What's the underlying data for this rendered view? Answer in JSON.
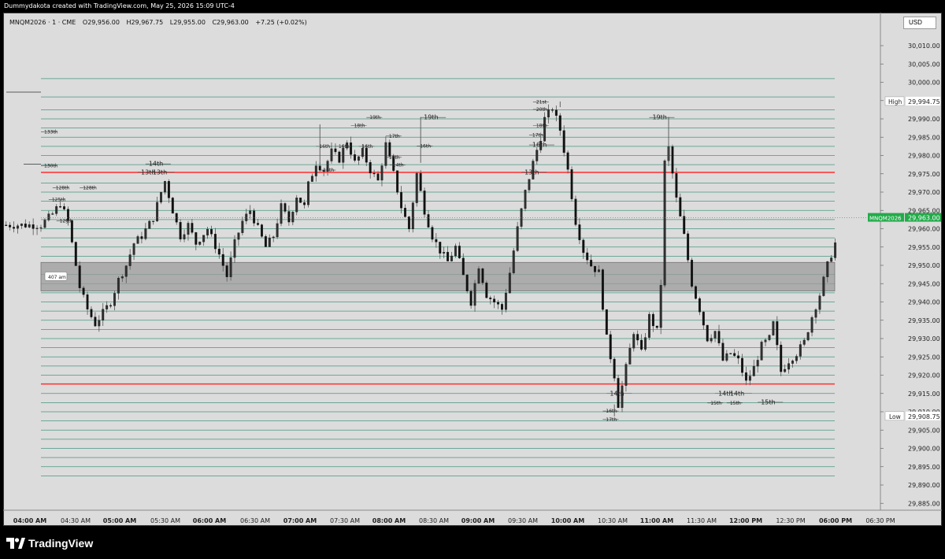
{
  "header": {
    "credit": "Dummydakota created with TradingView.com, May 25, 2026 15:09 UTC-4"
  },
  "legend": {
    "symbol": "MNQM2026 · 1 · CME",
    "open": "O29,956.00",
    "high": "H29,967.75",
    "low": "L29,955.00",
    "close": "C29,963.00",
    "change": "+7.25 (+0.02%)"
  },
  "currency": "USD",
  "brand": "TradingView",
  "colors": {
    "pane_bg": "#dcdcdc",
    "candle": "#111111",
    "candle_wick": "#555555",
    "level_line": "#2e8b72",
    "red_line": "#ff3b3b",
    "zone_fill": "#9c9c9c",
    "price_tag": "#22ab4a"
  },
  "chart_data": {
    "type": "candlestick",
    "symbol": "MNQM2026",
    "interval": "1",
    "y_range": [
      29882.5,
      30015
    ],
    "y_ticks": [
      "30,010.00",
      "30,005.00",
      "30,000.00",
      "29,995.00",
      "29,990.00",
      "29,985.00",
      "29,980.00",
      "29,975.00",
      "29,970.00",
      "29,965.00",
      "29,960.00",
      "29,955.00",
      "29,950.00",
      "29,945.00",
      "29,940.00",
      "29,935.00",
      "29,930.00",
      "29,925.00",
      "29,920.00",
      "29,915.00",
      "29,910.00",
      "29,905.00",
      "29,900.00",
      "29,895.00",
      "29,890.00",
      "29,885.00"
    ],
    "x_ticks": [
      "04:00 AM",
      "04:30 AM",
      "05:00 AM",
      "05:30 AM",
      "06:00 AM",
      "06:30 AM",
      "07:00 AM",
      "07:30 AM",
      "08:00 AM",
      "08:30 AM",
      "09:00 AM",
      "09:30 AM",
      "10:00 AM",
      "10:30 AM",
      "11:00 AM",
      "11:30 AM",
      "12:00 PM",
      "12:30 PM",
      "06:00 PM",
      "06:30 PM"
    ],
    "x_ticks_bold": [
      "04:00 AM",
      "05:00 AM",
      "06:00 AM",
      "07:00 AM",
      "08:00 AM",
      "09:00 AM",
      "10:00 AM",
      "11:00 AM",
      "12:00 PM",
      "06:00 PM"
    ],
    "high_label": {
      "text": "High",
      "value": "29,994.75",
      "price": 29994.75
    },
    "low_label": {
      "text": "Low",
      "value": "29,908.75",
      "price": 29908.75
    },
    "last_price": {
      "symbol": "MNQM2026",
      "value": "29,963.00",
      "price": 29963.0
    },
    "red_levels": [
      29975.4,
      29917.6
    ],
    "zone": {
      "from": 29943.0,
      "to": 29950.8,
      "label": "407 am"
    },
    "level_lines": [
      30001,
      29996,
      29992.5,
      29990,
      29987.5,
      29985,
      29982.5,
      29980,
      29977.5,
      29972.5,
      29970,
      29967.5,
      29965,
      29962.5,
      29960,
      29957.5,
      29955,
      29952.5,
      29947.5,
      29945,
      29942.5,
      29940,
      29937.5,
      29935,
      29932.5,
      29930,
      29927.5,
      29925,
      29922.5,
      29920,
      29915,
      29912.5,
      29910,
      29907.5,
      29905,
      29902.5,
      29900,
      29897.5,
      29895,
      29892.5
    ],
    "price_path": [
      [
        0,
        29961
      ],
      [
        3,
        29964
      ],
      [
        5,
        29967
      ],
      [
        7,
        29962
      ],
      [
        9,
        29950
      ],
      [
        10,
        29944
      ],
      [
        12,
        29938
      ],
      [
        14,
        29934
      ],
      [
        16,
        29937
      ],
      [
        18,
        29940
      ],
      [
        20,
        29946
      ],
      [
        22,
        29950
      ],
      [
        24,
        29956
      ],
      [
        26,
        29958
      ],
      [
        29,
        29963
      ],
      [
        31,
        29970
      ],
      [
        32,
        29973
      ],
      [
        34,
        29965
      ],
      [
        36,
        29958
      ],
      [
        38,
        29961
      ],
      [
        40,
        29956
      ],
      [
        43,
        29960
      ],
      [
        46,
        29953
      ],
      [
        48,
        29947
      ],
      [
        50,
        29956
      ],
      [
        52,
        29962
      ],
      [
        54,
        29965
      ],
      [
        56,
        29960
      ],
      [
        58,
        29955
      ],
      [
        60,
        29958
      ],
      [
        62,
        29966
      ],
      [
        64,
        29962
      ],
      [
        66,
        29969
      ],
      [
        68,
        29966
      ],
      [
        69,
        29972
      ],
      [
        71,
        29978
      ],
      [
        73,
        29976
      ],
      [
        75,
        29981
      ],
      [
        77,
        29979
      ],
      [
        79,
        29984
      ],
      [
        81,
        29978
      ],
      [
        83,
        29981
      ],
      [
        85,
        29976
      ],
      [
        87,
        29973
      ],
      [
        89,
        29983
      ],
      [
        91,
        29975
      ],
      [
        93,
        29966
      ],
      [
        95,
        29960
      ],
      [
        97,
        29975
      ],
      [
        99,
        29965
      ],
      [
        101,
        29958
      ],
      [
        103,
        29954
      ],
      [
        105,
        29951
      ],
      [
        107,
        29955
      ],
      [
        109,
        29947
      ],
      [
        111,
        29940
      ],
      [
        113,
        29950
      ],
      [
        115,
        29942
      ],
      [
        117,
        29940
      ],
      [
        119,
        29938
      ],
      [
        121,
        29948
      ],
      [
        123,
        29960
      ],
      [
        125,
        29970
      ],
      [
        127,
        29978
      ],
      [
        129,
        29985
      ],
      [
        130,
        29990
      ],
      [
        132,
        29993
      ],
      [
        134,
        29987
      ],
      [
        136,
        29976
      ],
      [
        138,
        29962
      ],
      [
        140,
        29954
      ],
      [
        142,
        29950
      ],
      [
        144,
        29948
      ],
      [
        146,
        29930
      ],
      [
        148,
        29920
      ],
      [
        149,
        29912
      ],
      [
        151,
        29922
      ],
      [
        153,
        29932
      ],
      [
        155,
        29926
      ],
      [
        157,
        29936
      ],
      [
        159,
        29932
      ],
      [
        160,
        29945
      ],
      [
        161,
        29978
      ],
      [
        162,
        29982
      ],
      [
        164,
        29968
      ],
      [
        166,
        29958
      ],
      [
        168,
        29945
      ],
      [
        170,
        29938
      ],
      [
        172,
        29930
      ],
      [
        174,
        29932
      ],
      [
        176,
        29924
      ],
      [
        178,
        29926
      ],
      [
        180,
        29924
      ],
      [
        182,
        29918
      ],
      [
        184,
        29922
      ],
      [
        186,
        29928
      ],
      [
        188,
        29930
      ],
      [
        189,
        29934
      ],
      [
        191,
        29921
      ],
      [
        193,
        29924
      ],
      [
        195,
        29926
      ],
      [
        197,
        29929
      ],
      [
        199,
        29936
      ],
      [
        201,
        29942
      ],
      [
        203,
        29950
      ],
      [
        205,
        29956
      ],
      [
        207,
        29963
      ]
    ],
    "swing_labels": [
      {
        "t": "133th",
        "x": 0,
        "y": 29986.5,
        "size": "s"
      },
      {
        "t": "130th",
        "x": 0,
        "y": 29977.2,
        "size": "s"
      },
      {
        "t": "128th",
        "x": 3,
        "y": 29971.2,
        "size": "s"
      },
      {
        "t": "128th",
        "x": 10,
        "y": 29971.2,
        "size": "s"
      },
      {
        "t": "125th",
        "x": 2,
        "y": 29968.0,
        "size": "s"
      },
      {
        "t": "12§th",
        "x": 4,
        "y": 29962.2,
        "size": "s"
      },
      {
        "t": "14th",
        "x": 27,
        "y": 29977.7,
        "size": "m"
      },
      {
        "t": "13th",
        "x": 25,
        "y": 29975.4,
        "size": "m"
      },
      {
        "t": "13th",
        "x": 28,
        "y": 29975.4,
        "size": "m"
      },
      {
        "t": "18th",
        "x": 80,
        "y": 29988.2,
        "size": "s"
      },
      {
        "t": "16th",
        "x": 71,
        "y": 29982.5,
        "size": "s"
      },
      {
        "t": "16th",
        "x": 76,
        "y": 29982.5,
        "size": "s"
      },
      {
        "t": "16th",
        "x": 82,
        "y": 29982.5,
        "size": "s"
      },
      {
        "t": "15th",
        "x": 72,
        "y": 29976.0,
        "size": "s"
      },
      {
        "t": "19th",
        "x": 84,
        "y": 29990.4,
        "size": "s"
      },
      {
        "t": "17th",
        "x": 89,
        "y": 29985.3,
        "size": "s"
      },
      {
        "t": "16th",
        "x": 97,
        "y": 29982.6,
        "size": "s"
      },
      {
        "t": "15th",
        "x": 89,
        "y": 29979.5,
        "size": "s"
      },
      {
        "t": "14th",
        "x": 90,
        "y": 29977.4,
        "size": "s"
      },
      {
        "t": "19th",
        "x": 98,
        "y": 29990.4,
        "size": "m"
      },
      {
        "t": "21st",
        "x": 127,
        "y": 29994.6,
        "size": "s"
      },
      {
        "t": "20th",
        "x": 127,
        "y": 29992.6,
        "size": "s"
      },
      {
        "t": "18th",
        "x": 127,
        "y": 29988.2,
        "size": "s"
      },
      {
        "t": "17th",
        "x": 126,
        "y": 29985.6,
        "size": "s"
      },
      {
        "t": "16th",
        "x": 126,
        "y": 29982.9,
        "size": "m"
      },
      {
        "t": "13th",
        "x": 124,
        "y": 29975.4,
        "size": "m"
      },
      {
        "t": "19th",
        "x": 157,
        "y": 29990.4,
        "size": "m"
      },
      {
        "t": "14th",
        "x": 146,
        "y": 29915.0,
        "size": "m"
      },
      {
        "t": "16th",
        "x": 145,
        "y": 29910.2,
        "size": "s"
      },
      {
        "t": "17th",
        "x": 145,
        "y": 29907.9,
        "size": "s"
      },
      {
        "t": "14th",
        "x": 174,
        "y": 29915.0,
        "size": "m"
      },
      {
        "t": "14th",
        "x": 177,
        "y": 29915.0,
        "size": "m"
      },
      {
        "t": "15th",
        "x": 172,
        "y": 29912.4,
        "size": "s"
      },
      {
        "t": "15th",
        "x": 177,
        "y": 29912.4,
        "size": "s"
      },
      {
        "t": "15th",
        "x": 185,
        "y": 29912.6,
        "size": "m"
      }
    ],
    "grid": false,
    "legend_position": "top-left"
  }
}
